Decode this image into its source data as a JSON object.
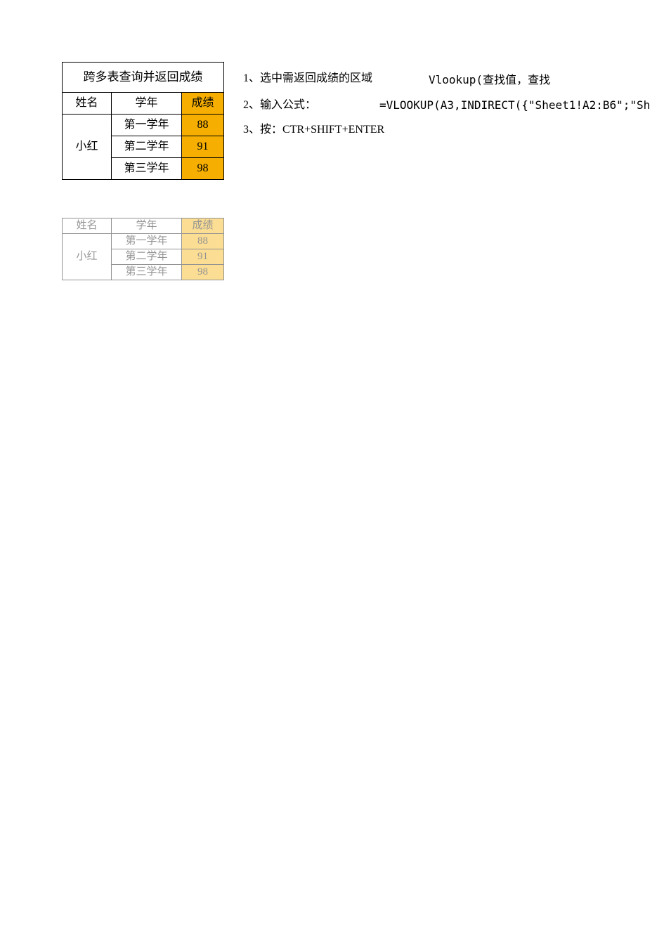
{
  "table1": {
    "title": "跨多表查询并返回成绩",
    "headers": {
      "name": "姓名",
      "year": "学年",
      "score": "成绩"
    },
    "student": "小红",
    "rows": [
      {
        "year": "第一学年",
        "score": "88"
      },
      {
        "year": "第二学年",
        "score": "91"
      },
      {
        "year": "第三学年",
        "score": "98"
      }
    ]
  },
  "instructions": {
    "i1": "1、选中需返回成绩的区域",
    "i2": "2、输入公式：",
    "i3": "3、按：CTR+SHIFT+ENTER"
  },
  "vlookup_hint": "Vlookup(查找值，查找",
  "formula": "=VLOOKUP(A3,INDIRECT({\"Sheet1!A2:B6\";\"Sh",
  "table2": {
    "headers": {
      "name": "姓名",
      "year": "学年",
      "score": "成绩"
    },
    "student": "小红",
    "rows": [
      {
        "year": "第一学年",
        "score": "88"
      },
      {
        "year": "第二学年",
        "score": "91"
      },
      {
        "year": "第三学年",
        "score": "98"
      }
    ]
  },
  "colors": {
    "highlight": "#f6af00"
  }
}
